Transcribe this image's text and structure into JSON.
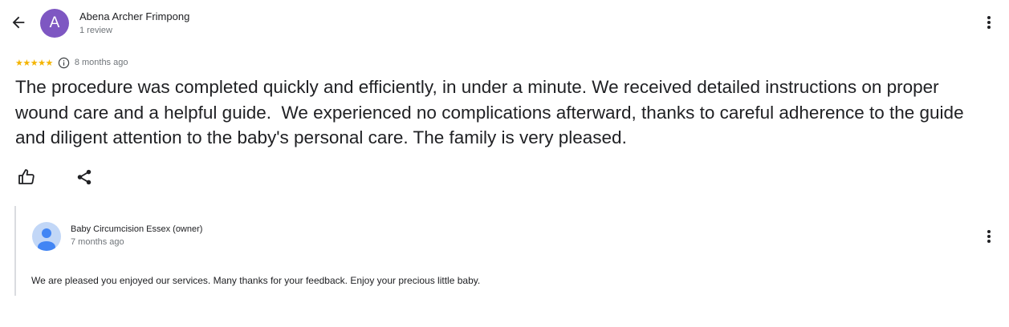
{
  "review": {
    "author_initial": "A",
    "author_name": "Abena Archer Frimpong",
    "author_review_count": "1 review",
    "rating_stars": "★★★★★",
    "rating": 5,
    "time_ago": "8 months ago",
    "text": "The procedure was completed quickly and efficiently, in under a minute. We received detailed instructions on proper wound care and a helpful guide.  We experienced no complications afterward, thanks to careful adherence to the guide and diligent attention to the baby's personal care. The family is very pleased."
  },
  "owner_reply": {
    "name": "Baby Circumcision Essex (owner)",
    "time_ago": "7 months ago",
    "text": "We are pleased you enjoyed our services. Many thanks for your feedback. Enjoy your precious little baby."
  },
  "icons": {
    "back": "arrow-back-icon",
    "more": "more-vert-icon",
    "info": "info-icon",
    "like": "thumb-up-icon",
    "share": "share-icon",
    "owner_avatar": "person-icon"
  },
  "colors": {
    "avatar": "#7e57c2",
    "stars": "#f4b400",
    "owner_avatar_bg": "#c2d7f7",
    "owner_avatar_fg": "#4285f4",
    "secondary_text": "#70757a",
    "divider": "#dadce0"
  }
}
